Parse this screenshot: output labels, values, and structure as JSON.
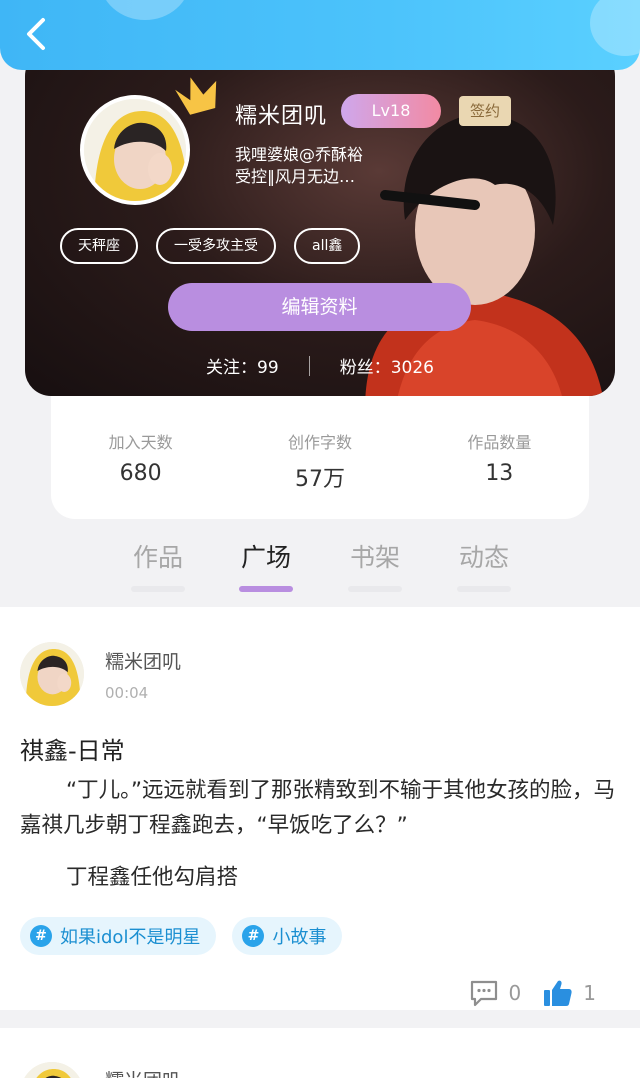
{
  "profile": {
    "nickname": "糯米团叽",
    "level": "Lv18",
    "sign_badge": "签约",
    "bio_line1": "我哩婆娘@乔酥裕",
    "bio_line2": "受控‖风月无边…",
    "tags": [
      "天秤座",
      "一受多攻主受",
      "all鑫"
    ],
    "edit_button": "编辑资料",
    "following_label": "关注：",
    "following": "99",
    "fans_label": "粉丝：",
    "fans": "3026"
  },
  "stats": [
    {
      "label": "加入天数",
      "value": "680"
    },
    {
      "label": "创作字数",
      "value": "57万"
    },
    {
      "label": "作品数量",
      "value": "13"
    }
  ],
  "tabs": [
    {
      "label": "作品",
      "active": false
    },
    {
      "label": "广场",
      "active": true
    },
    {
      "label": "书架",
      "active": false
    },
    {
      "label": "动态",
      "active": false
    }
  ],
  "post": {
    "author": "糯米团叽",
    "time": "00:04",
    "title": "祺鑫-日常",
    "body": "“丁儿。”远远就看到了那张精致到不输于其他女孩的脸，马嘉祺几步朝丁程鑫跑去，“早饭吃了么？”",
    "body2": "丁程鑫任他勾肩搭",
    "topics": [
      "如果idol不是明星",
      "小故事"
    ],
    "comments": "0",
    "likes": "1"
  },
  "next_post": {
    "author": "糯米团叽"
  },
  "colors": {
    "topbar": "#4cc3fb",
    "accent_purple": "#b98ee0",
    "topic_blue": "#2aa3ea"
  }
}
